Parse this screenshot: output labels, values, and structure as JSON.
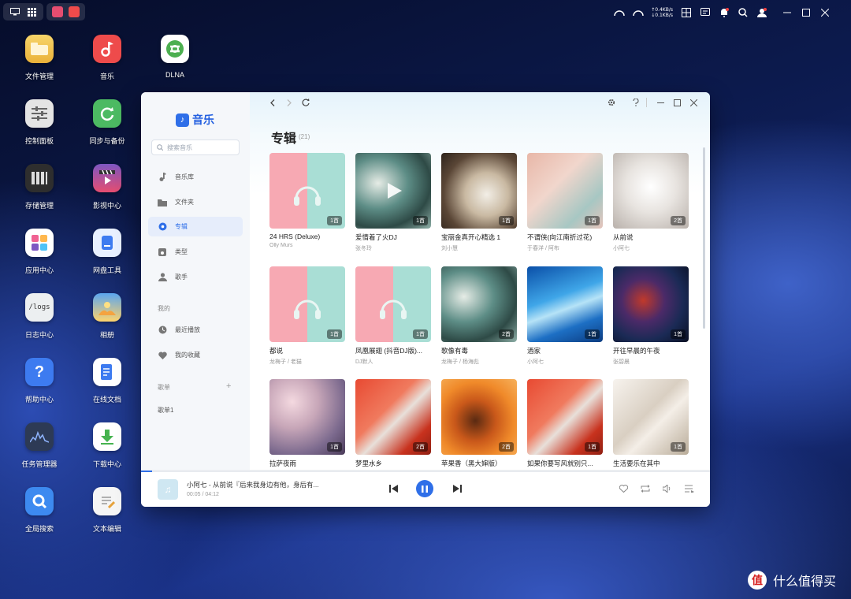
{
  "desktop_icons": [
    {
      "label": "文件管理",
      "icon": "folder-icon",
      "color": "#f2c24a"
    },
    {
      "label": "音乐",
      "icon": "music-icon",
      "color": "#ee4b4b"
    },
    {
      "label": "DLNA",
      "icon": "dlna-icon",
      "color": "#4caf50"
    },
    {
      "label": "控制面板",
      "icon": "sliders-icon",
      "color": "#d9d9d9"
    },
    {
      "label": "同步与备份",
      "icon": "sync-icon",
      "color": "#4cba62"
    },
    {
      "label": "存储管理",
      "icon": "drives-icon",
      "color": "#3a3a3a"
    },
    {
      "label": "影视中心",
      "icon": "video-icon",
      "color": "#e64d70"
    },
    {
      "label": "应用中心",
      "icon": "apps-icon",
      "color": "#ffffff"
    },
    {
      "label": "网盘工具",
      "icon": "cloud-drive-icon",
      "color": "#3d7bf0"
    },
    {
      "label": "日志中心",
      "icon": "logs-icon",
      "color": "#e8e8e8"
    },
    {
      "label": "相册",
      "icon": "photo-icon",
      "color": "#5aa6f0"
    },
    {
      "label": "帮助中心",
      "icon": "help-icon",
      "color": "#3d7bf0"
    },
    {
      "label": "在线文档",
      "icon": "document-icon",
      "color": "#3d7bf0"
    },
    {
      "label": "任务管理器",
      "icon": "task-chart-icon",
      "color": "#2d3a55"
    },
    {
      "label": "下载中心",
      "icon": "download-icon",
      "color": "#46b34f"
    },
    {
      "label": "全局搜索",
      "icon": "global-search-icon",
      "color": "#3d8af0"
    },
    {
      "label": "文本编辑",
      "icon": "text-edit-icon",
      "color": "#f5f5f5"
    }
  ],
  "topbar": {
    "network_up": "↑0.4KB/s",
    "network_down": "↓0.1KB/s"
  },
  "app": {
    "logo": "音乐",
    "search_placeholder": "搜索音乐",
    "nav": [
      {
        "label": "音乐库",
        "icon": "note-icon"
      },
      {
        "label": "文件夹",
        "icon": "folder-icon"
      },
      {
        "label": "专辑",
        "icon": "album-icon"
      },
      {
        "label": "类型",
        "icon": "genre-icon"
      },
      {
        "label": "歌手",
        "icon": "singer-icon"
      }
    ],
    "mine_header": "我的",
    "mine_items": [
      {
        "label": "最近播放",
        "icon": "clock-icon"
      },
      {
        "label": "我的收藏",
        "icon": "heart-icon"
      }
    ],
    "playlist_header": "歌单",
    "playlist_add": "+",
    "playlists": [
      "歌单1"
    ],
    "page_title": "专辑",
    "album_count": "(21)",
    "albums": [
      {
        "name": "24 HRS (Deluxe)",
        "artist": "Olly Murs",
        "count": "1首",
        "cover": "pink-teal"
      },
      {
        "name": "爱情着了火DJ",
        "artist": "张冬玲",
        "count": "1首",
        "cover": "teal-wave"
      },
      {
        "name": "宝丽金真开心精选 1",
        "artist": "刘小慧",
        "count": "1首",
        "cover": "coffee"
      },
      {
        "name": "不谓侠(向江南折过花)",
        "artist": "于春洋 / 阿布",
        "count": "1首",
        "cover": "peach-teal"
      },
      {
        "name": "从前说",
        "artist": "小阿七",
        "count": "2首",
        "cover": "white-flower"
      },
      {
        "name": "都说",
        "artist": "龙梅子 / 老猫",
        "count": "1首",
        "cover": "pink-teal"
      },
      {
        "name": "凤凰展翅 (抖音DJ版)...",
        "artist": "DJ默人",
        "count": "1首",
        "cover": "pink-teal"
      },
      {
        "name": "歌像有毒",
        "artist": "龙梅子 / 杨海彪",
        "count": "2首",
        "cover": "teal-wave"
      },
      {
        "name": "酒家",
        "artist": "小阿七",
        "count": "1首",
        "cover": "blue-streak"
      },
      {
        "name": "开往早晨的午夜",
        "artist": "张碧晨",
        "count": "1首",
        "cover": "dark-paint"
      },
      {
        "name": "拉萨夜雨",
        "artist": "",
        "count": "1首",
        "cover": "bokeh"
      },
      {
        "name": "梦里水乡",
        "artist": "",
        "count": "2首",
        "cover": "red-art"
      },
      {
        "name": "苹果香（黑大婶版）",
        "artist": "",
        "count": "2首",
        "cover": "orange-blur"
      },
      {
        "name": "如果你要写风就别只...",
        "artist": "",
        "count": "1首",
        "cover": "red-art"
      },
      {
        "name": "生活要乐在其中",
        "artist": "",
        "count": "1首",
        "cover": "white-rays"
      }
    ],
    "player": {
      "title": "小阿七 - 从前说『后来我身边有他，身后有...",
      "time": "00:05 / 04:12",
      "progress": 0.02
    }
  },
  "watermark": {
    "logo": "值",
    "text": "什么值得买"
  },
  "colors": {
    "accent": "#2f6fe8"
  }
}
